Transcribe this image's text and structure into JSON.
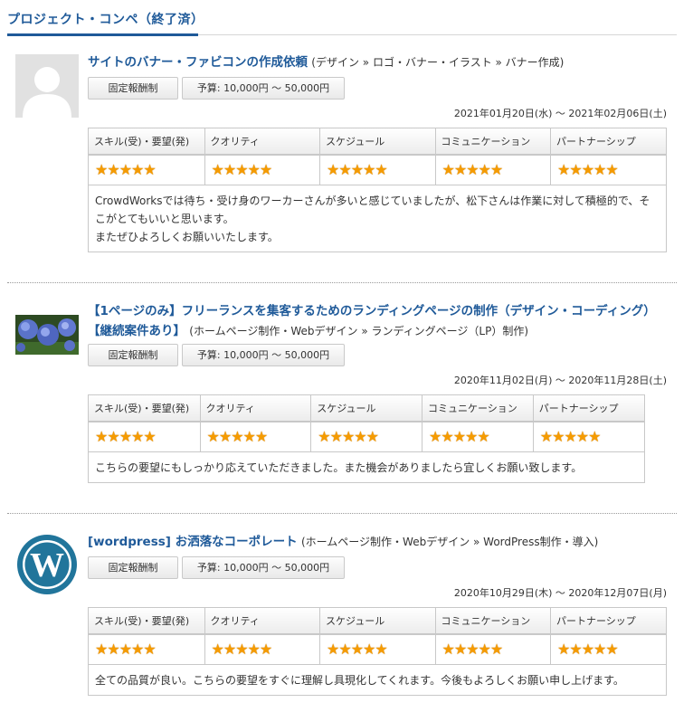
{
  "section": {
    "title": "プロジェクト・コンペ（終了済）"
  },
  "headers": [
    "スキル(受)・要望(発)",
    "クオリティ",
    "スケジュール",
    "コミュニケーション",
    "パートナーシップ"
  ],
  "ratings": [
    5,
    5,
    5,
    5,
    5
  ],
  "entries": [
    {
      "thumb": "default-avatar",
      "title": "サイトのバナー・ファビコンの作成依頼",
      "category": "(デザイン » ロゴ・バナー・イラスト » バナー作成)",
      "contract": "固定報酬制",
      "budget": "予算: 10,000円 〜 50,000円",
      "dates": "2021年01月20日(水) 〜 2021年02月06日(土)",
      "comment": "CrowdWorksでは待ち・受け身のワーカーさんが多いと感じていましたが、松下さんは作業に対して積極的で、そこがとてもいいと思います。\nまたぜひよろしくお願いいたします。"
    },
    {
      "thumb": "hydrangea-photo",
      "title": "【1ページのみ】フリーランスを集客するためのランディングページの制作（デザイン・コーディング）【継続案件あり】",
      "category": "(ホームページ制作・Webデザイン » ランディングページ（LP）制作)",
      "contract": "固定報酬制",
      "budget": "予算: 10,000円 〜 50,000円",
      "dates": "2020年11月02日(月) 〜 2020年11月28日(土)",
      "comment": "こちらの要望にもしっかり応えていただきました。また機会がありましたら宜しくお願い致します。"
    },
    {
      "thumb": "wordpress-logo",
      "title": "[wordpress] お洒落なコーポレート",
      "category": "(ホームページ制作・Webデザイン » WordPress制作・導入)",
      "contract": "固定報酬制",
      "budget": "予算: 10,000円 〜 50,000円",
      "dates": "2020年10月29日(木) 〜 2020年12月07日(月)",
      "comment": "全ての品質が良い。こちらの要望をすぐに理解し具現化してくれます。今後もよろしくお願い申し上げます。"
    }
  ]
}
